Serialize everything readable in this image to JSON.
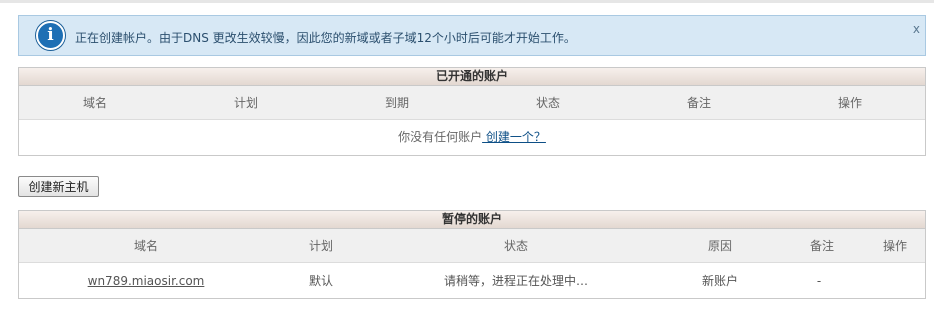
{
  "notice": {
    "message": "正在创建帐户。由于DNS 更改生效较慢，因此您的新域或者子域12个小时后可能才开始工作。",
    "close_label": "x",
    "icon": "info-icon"
  },
  "active_accounts": {
    "title": "已开通的账户",
    "columns": [
      "域名",
      "计划",
      "到期",
      "状态",
      "备注",
      "操作"
    ],
    "empty_text": "你没有任何账户",
    "empty_link": " 创建一个？"
  },
  "create_button_label": "创建新主机",
  "suspended_accounts": {
    "title": "暂停的账户",
    "columns": [
      "域名",
      "计划",
      "状态",
      "原因",
      "备注",
      "操作"
    ],
    "rows": [
      {
        "domain": "wn789.miaosir.com",
        "plan": "默认",
        "status": "请稍等，进程正在处理中…",
        "reason": "新账户",
        "note": "-",
        "action": ""
      }
    ]
  }
}
